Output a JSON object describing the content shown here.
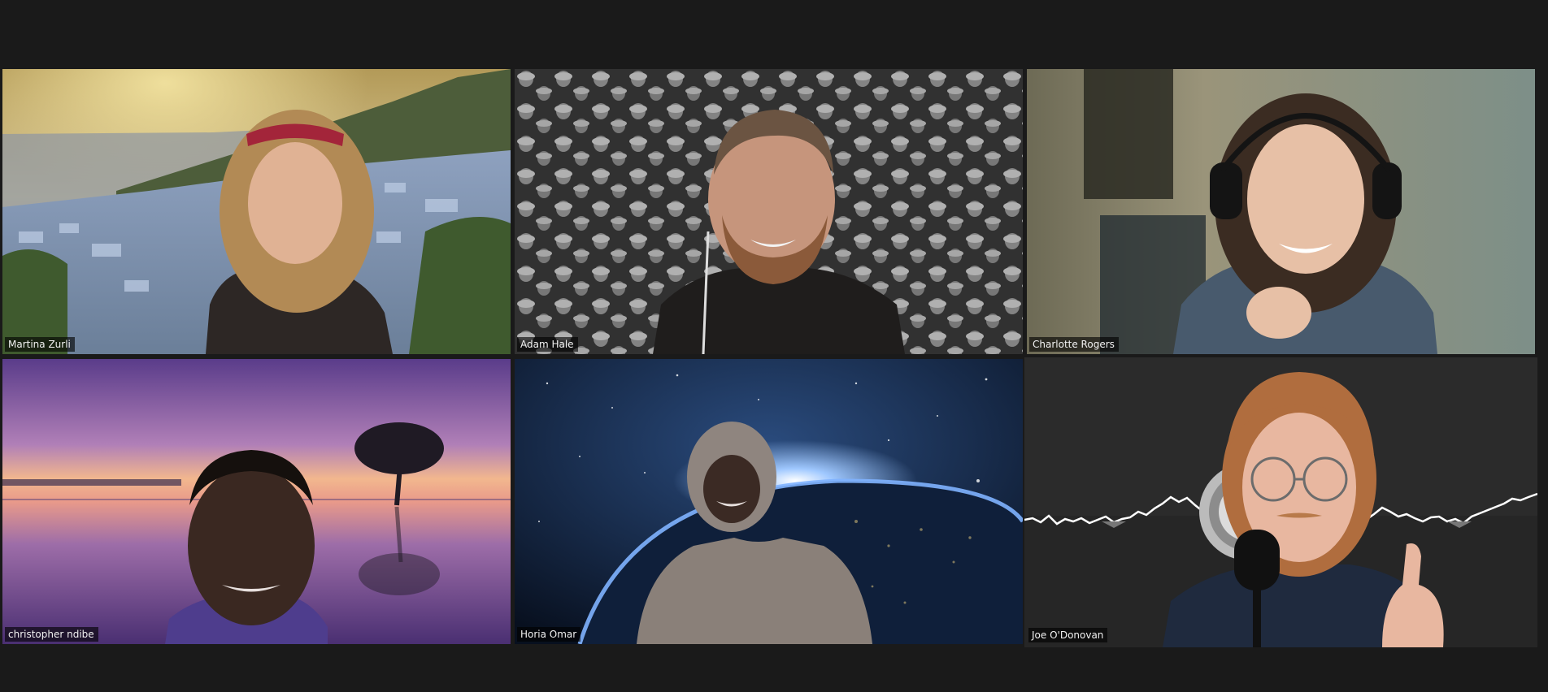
{
  "meeting": {
    "view": "gallery",
    "active_speaker": "Joe O'Donovan",
    "active_speaker_border_color": "#dfe37b"
  },
  "participants": [
    {
      "name": "Martina Zurli",
      "background": "mountain-town-at-sunset",
      "position": "row1-col1"
    },
    {
      "name": "Adam Hale",
      "background": "monochrome-pattern-of-faces",
      "position": "row1-col2"
    },
    {
      "name": "Charlotte Rogers",
      "background": "blurred-room",
      "position": "row1-col3"
    },
    {
      "name": "christopher ndibe",
      "background": "purple-sunset-lake-with-tree",
      "position": "row2-col1"
    },
    {
      "name": "Horia Omar",
      "background": "earth-from-space",
      "position": "row2-col2"
    },
    {
      "name": "Joe O'Donovan",
      "background": "audio-waveform",
      "position": "row2-col3",
      "active": true
    }
  ]
}
